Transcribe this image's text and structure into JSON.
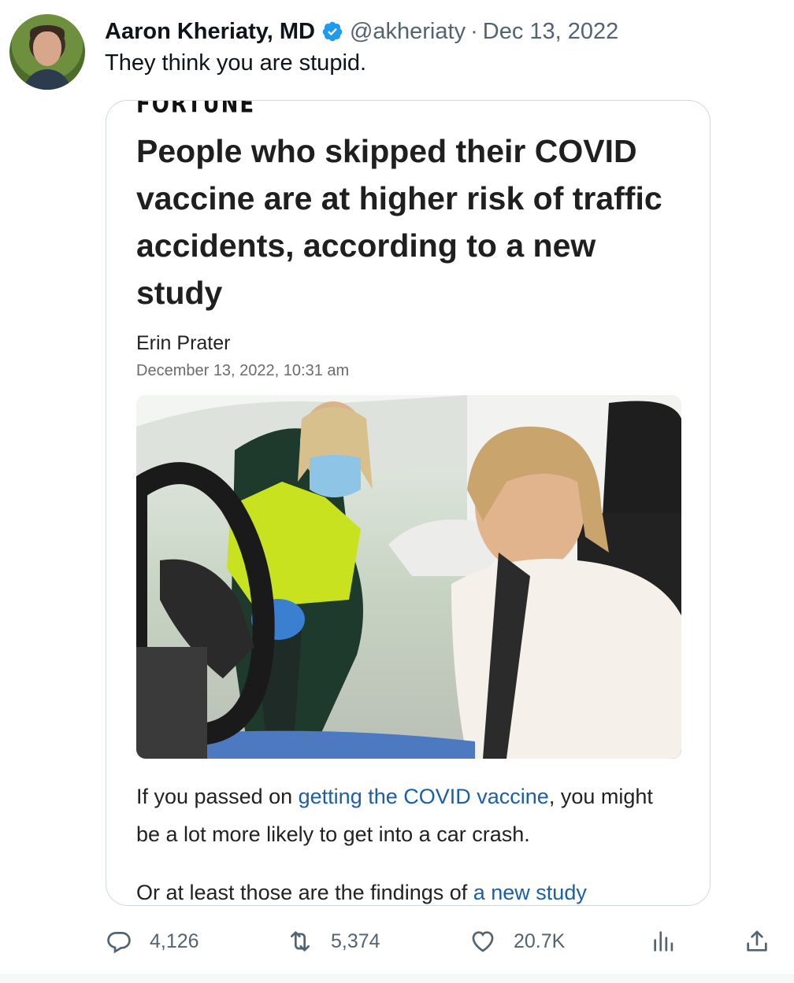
{
  "tweet": {
    "author_name": "Aaron Kheriaty, MD",
    "handle": "@akheriaty",
    "separator": "·",
    "date": "Dec 13, 2022",
    "text": "They think you are stupid."
  },
  "article_card": {
    "brand": "FORTUNE",
    "headline": "People who skipped their COVID vaccine are at higher risk of traffic accidents, according to a new study",
    "author": "Erin Prater",
    "date": "December 13, 2022, 10:31 am",
    "para1_before": "If you passed on ",
    "para1_link": "getting the COVID vaccine",
    "para1_after": ", you might be a lot more likely to get into a car crash.",
    "para2_before": "Or at least those are the findings of ",
    "para2_link": "a new study"
  },
  "actions": {
    "replies": "4,126",
    "retweets": "5,374",
    "likes": "20.7K"
  },
  "icons": {
    "verified": "verified-badge-icon",
    "reply": "reply-icon",
    "retweet": "retweet-icon",
    "like": "heart-icon",
    "views": "analytics-icon",
    "share": "share-icon"
  },
  "colors": {
    "verified": "#1d9bf0",
    "link": "#1a5fa8",
    "muted": "#536471"
  }
}
